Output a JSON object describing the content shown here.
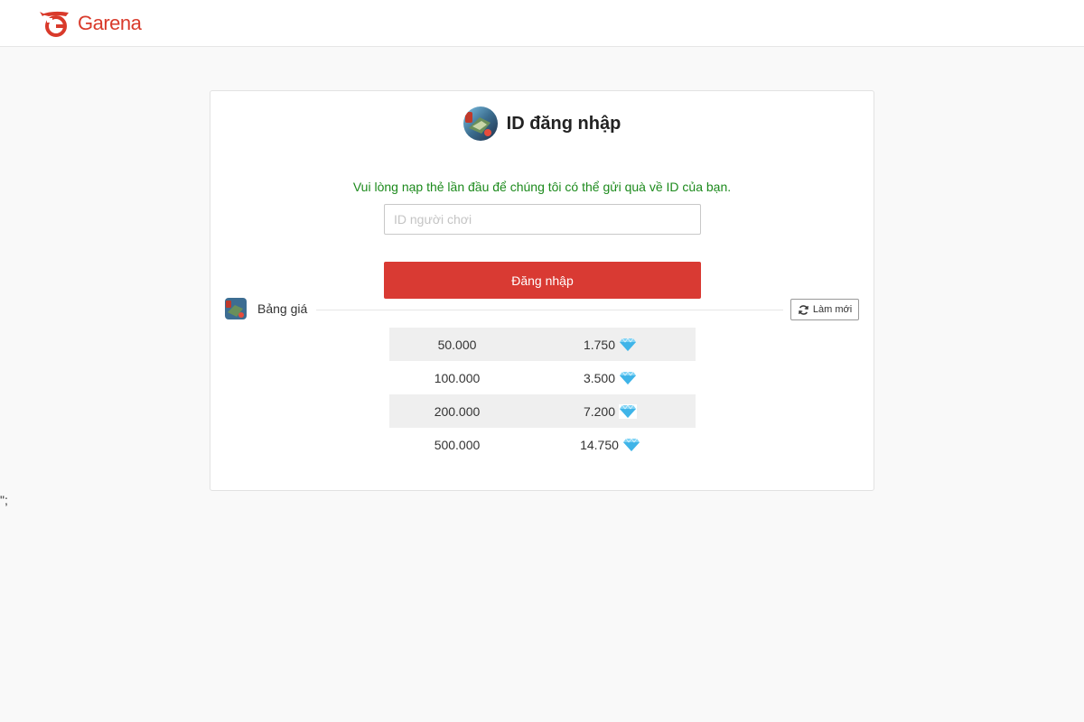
{
  "header": {
    "brand": "Garena",
    "brand_color": "#d93a2b",
    "logo_icon": "garena-logo-icon"
  },
  "stray_text": "\";",
  "login": {
    "title": "ID đăng nhập",
    "game_icon": "free-fire-game-icon",
    "notice": "Vui lòng nạp thẻ lần đầu để chúng tôi có thể gửi quà về ID của bạn.",
    "notice_color": "#1c8a1c",
    "input_placeholder": "ID người chơi",
    "input_value": "",
    "submit_label": "Đăng nhập",
    "submit_color": "#d93a33"
  },
  "price": {
    "title": "Bảng giá",
    "refresh_label": "Làm mới",
    "refresh_icon": "refresh-icon",
    "currency_icon": "diamond-icon",
    "rows": [
      {
        "vnd": "50.000",
        "diamonds": "1.750"
      },
      {
        "vnd": "100.000",
        "diamonds": "3.500"
      },
      {
        "vnd": "200.000",
        "diamonds": "7.200"
      },
      {
        "vnd": "500.000",
        "diamonds": "14.750"
      }
    ]
  }
}
